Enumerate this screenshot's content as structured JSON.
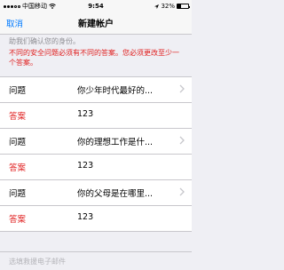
{
  "status_bar": {
    "carrier": "中国移动",
    "time": "9:54",
    "battery_percent_label": "32%",
    "battery_level": 0.32
  },
  "navbar": {
    "cancel_label": "取消",
    "title": "新建帐户"
  },
  "notice": {
    "gray_text": "助我们确认您的身份。",
    "red_text": "不同的安全问题必须有不同的答案。您必须更改至少一个答案。"
  },
  "rows": [
    {
      "label": "问题",
      "value": "你少年时代最好的..."
    },
    {
      "label": "答案",
      "value": "123"
    },
    {
      "label": "问题",
      "value": "你的理想工作是什..."
    },
    {
      "label": "答案",
      "value": "123"
    },
    {
      "label": "问题",
      "value": "你的父母是在哪里..."
    },
    {
      "label": "答案",
      "value": "123"
    }
  ],
  "footer": {
    "text": "选填救援电子邮件"
  }
}
